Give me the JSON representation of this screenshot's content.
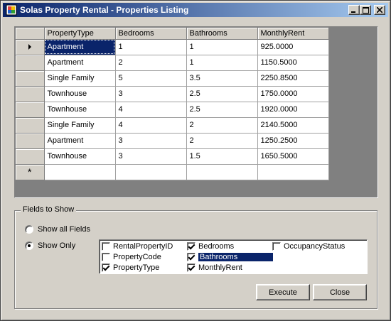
{
  "window": {
    "title": "Solas Property Rental - Properties Listing"
  },
  "grid": {
    "columns": [
      "PropertyType",
      "Bedrooms",
      "Bathrooms",
      "MonthlyRent"
    ],
    "rows": [
      [
        "Apartment",
        "1",
        "1",
        "925.0000"
      ],
      [
        "Apartment",
        "2",
        "1",
        "1150.5000"
      ],
      [
        "Single Family",
        "5",
        "3.5",
        "2250.8500"
      ],
      [
        "Townhouse",
        "3",
        "2.5",
        "1750.0000"
      ],
      [
        "Townhouse",
        "4",
        "2.5",
        "1920.0000"
      ],
      [
        "Single Family",
        "4",
        "2",
        "2140.5000"
      ],
      [
        "Apartment",
        "3",
        "2",
        "1250.2500"
      ],
      [
        "Townhouse",
        "3",
        "1.5",
        "1650.5000"
      ]
    ],
    "new_row_marker": "*"
  },
  "fields": {
    "group_label": "Fields to Show",
    "radio_all": "Show all Fields",
    "radio_only": "Show Only",
    "selected_radio": "only",
    "checklist": [
      {
        "label": "RentalPropertyID",
        "checked": false
      },
      {
        "label": "PropertyCode",
        "checked": false
      },
      {
        "label": "PropertyType",
        "checked": true
      },
      {
        "label": "Bedrooms",
        "checked": true
      },
      {
        "label": "Bathrooms",
        "checked": true,
        "highlighted": true
      },
      {
        "label": "MonthlyRent",
        "checked": true
      },
      {
        "label": "OccupancyStatus",
        "checked": false
      }
    ]
  },
  "buttons": {
    "execute": "Execute",
    "close": "Close"
  },
  "icons": {
    "app": "app-icon",
    "minimize": "minimize-icon",
    "maximize": "maximize-icon",
    "close": "close-icon"
  },
  "colors": {
    "title_start": "#0a246a",
    "title_end": "#a6caf0",
    "selection": "#0a246a",
    "face": "#d4d0c8"
  }
}
